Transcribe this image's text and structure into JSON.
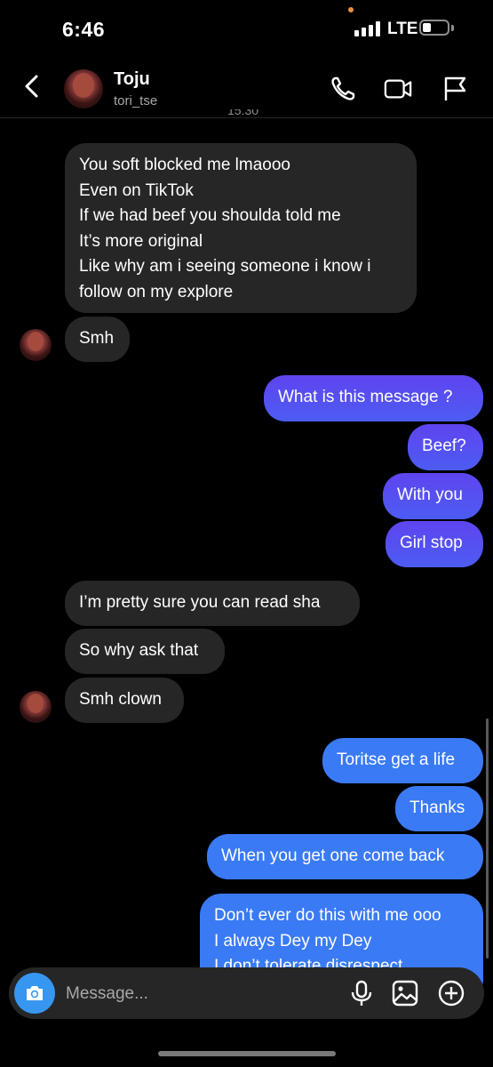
{
  "status_bar": {
    "time": "6:46",
    "network": "LTE"
  },
  "header": {
    "name": "Toju",
    "username": "tori_tse",
    "timestamp": "15:30"
  },
  "messages": {
    "m1": [
      "You soft blocked me lmaooo",
      "Even on TikTok",
      "If we had beef you shoulda told me",
      "It’s more original",
      "Like why am i seeing someone i know i",
      "follow on my explore"
    ],
    "m2": "Smh",
    "m3": "What is this message ?",
    "m4": "Beef?",
    "m5": "With you",
    "m6": "Girl stop",
    "m7": "I’m pretty sure you can read sha",
    "m8": "So why ask that",
    "m9": "Smh clown",
    "m10": "Toritse get a life",
    "m11": "Thanks",
    "m12": "When you get one come back",
    "m13": [
      "Don’t ever do this with me ooo",
      "I always Dey my Dey",
      "I don’t tolerate disrespect"
    ]
  },
  "composer": {
    "placeholder": "Message..."
  },
  "colors": {
    "outgoing_purple": "#5f44f0",
    "outgoing_blue": "#3a7af5",
    "incoming": "#262626",
    "camera_button": "#3797f0"
  },
  "icons": [
    "back-icon",
    "phone-icon",
    "video-icon",
    "flag-icon",
    "camera-icon",
    "microphone-icon",
    "gallery-icon",
    "plus-icon"
  ]
}
